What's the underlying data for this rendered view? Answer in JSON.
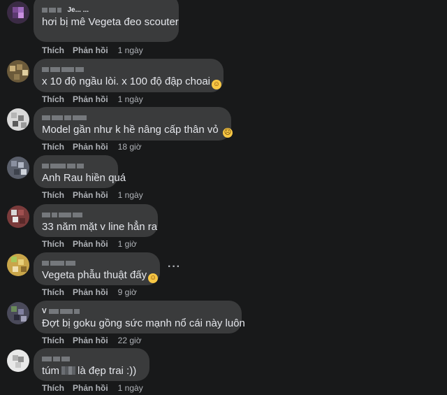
{
  "comments": [
    {
      "name": "Je... ...",
      "text": "hơi bị mê Vegeta đeo scouter",
      "emoji": "",
      "like": "Thích",
      "reply": "Phản hồi",
      "time": "1 ngày"
    },
    {
      "name": "",
      "text": "x 10 độ ngầu lòi. x 100 độ đập choai",
      "emoji": "laugh-emoji",
      "like": "Thích",
      "reply": "Phản hồi",
      "time": "1 ngày"
    },
    {
      "name": "",
      "text": "Model gần như k hề nâng cấp thân vỏ",
      "emoji": "sad-emoji",
      "like": "Thích",
      "reply": "Phản hồi",
      "time": "18 giờ"
    },
    {
      "name": "",
      "text": "Anh Rau hiền quá",
      "emoji": "",
      "like": "Thích",
      "reply": "Phản hồi",
      "time": "1 ngày"
    },
    {
      "name": "",
      "text": "33 năm mặt v line hẳn ra",
      "emoji": "",
      "like": "Thích",
      "reply": "Phản hồi",
      "time": "1 giờ"
    },
    {
      "name": "",
      "text": "Vegeta phẫu thuật đấy",
      "emoji": "laugh-emoji",
      "like": "Thích",
      "reply": "Phản hồi",
      "time": "9 giờ"
    },
    {
      "name": "V",
      "text": "Đợt bị goku gồng sức mạnh nổ cái này luôn",
      "emoji": "",
      "like": "Thích",
      "reply": "Phản hồi",
      "time": "22 giờ"
    },
    {
      "name": "",
      "text_before": "túm",
      "text_after": "là đẹp trai :))",
      "like": "Thích",
      "reply": "Phản hồi",
      "time": "1 ngày"
    }
  ],
  "more_icon": "ellipsis-icon"
}
